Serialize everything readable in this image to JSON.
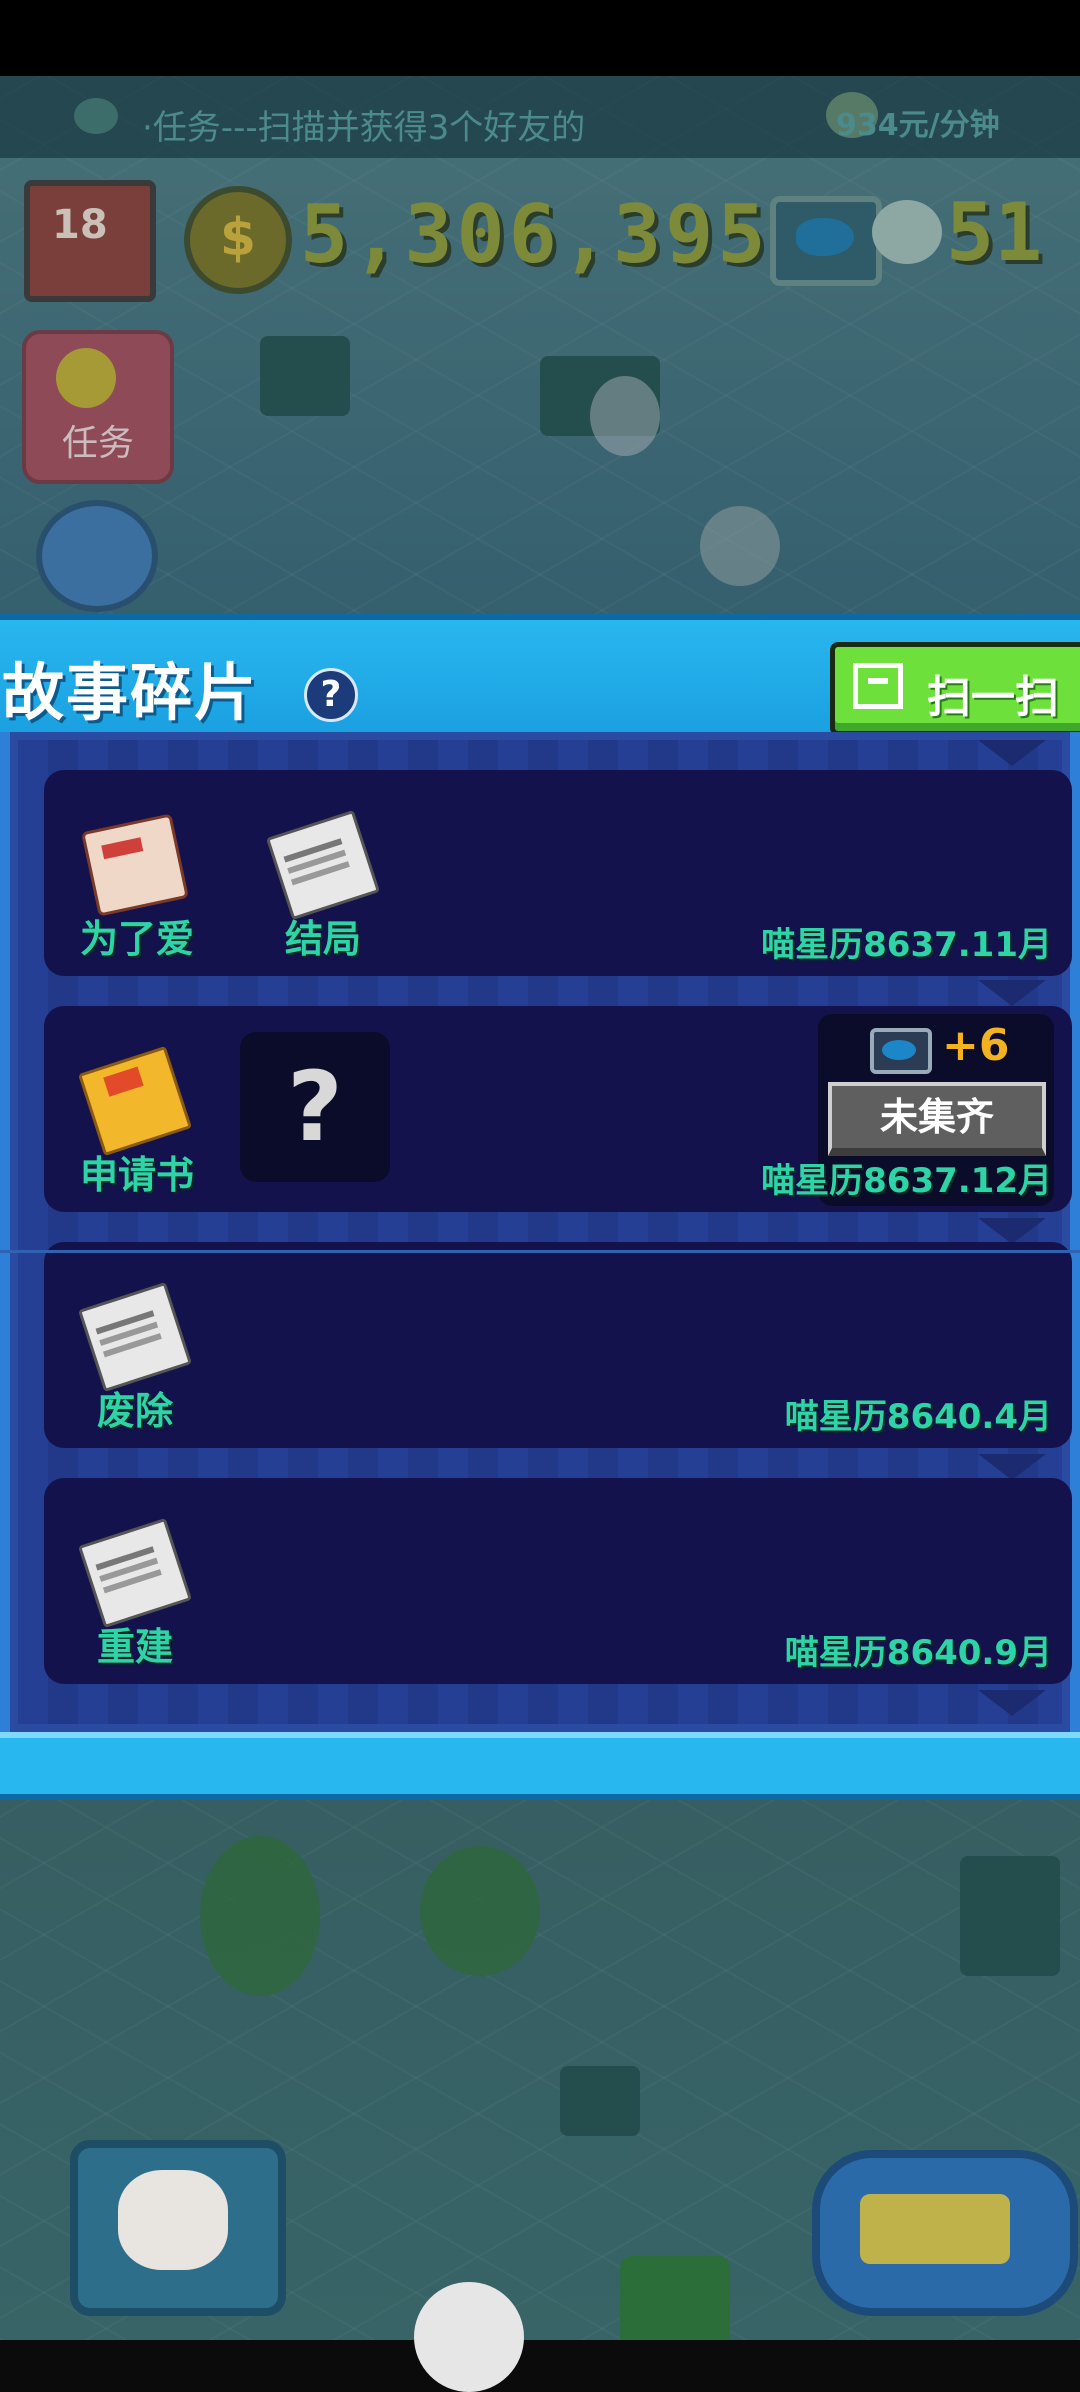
{
  "hud": {
    "ticker": "·任务---扫描并获得3个好友的",
    "income_rate": "934元/分钟",
    "money": "5,306,395",
    "coin_symbol": "$",
    "fish_count": "51",
    "calendar_day": "18",
    "task_button_label": "任务"
  },
  "panel": {
    "title": "故事碎片",
    "help_symbol": "?",
    "scan_button_label": "扫一扫",
    "stories": [
      {
        "fragments": [
          {
            "name": "为了爱",
            "icon": "tag-icon"
          },
          {
            "name": "结局",
            "icon": "newspaper-icon"
          }
        ],
        "date": "喵星历8637.11月"
      },
      {
        "fragments": [
          {
            "name": "申请书",
            "icon": "envelope-icon"
          }
        ],
        "unknown_symbol": "?",
        "reward": {
          "amount": "+6",
          "status": "未集齐"
        },
        "date": "喵星历8637.12月"
      },
      {
        "fragments": [
          {
            "name": "废除",
            "icon": "newspaper-icon"
          }
        ],
        "date": "喵星历8640.4月"
      },
      {
        "fragments": [
          {
            "name": "重建",
            "icon": "newspaper-icon"
          }
        ],
        "date": "喵星历8640.9月"
      }
    ]
  },
  "colors": {
    "header": "#29b7ef",
    "card": "#14124c",
    "fragment_text": "#2ed3a7",
    "scan_button": "#6ee03c",
    "reward_text": "#f3b21f"
  }
}
